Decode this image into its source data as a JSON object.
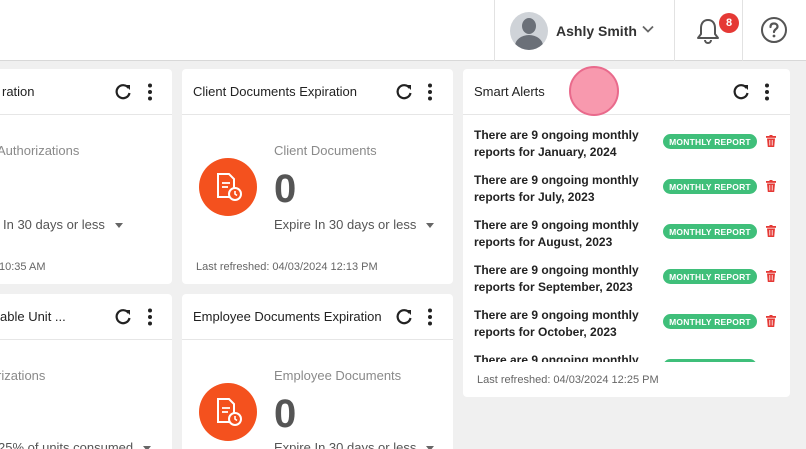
{
  "header": {
    "user_name": "Ashly Smith",
    "notification_count": "8"
  },
  "cards": {
    "authorizations": {
      "title": "ration",
      "stat_label": "Authorizations",
      "expire_text": "In 30 days or less",
      "refreshed": "10:35 AM"
    },
    "client_docs": {
      "title": "Client Documents Expiration",
      "stat_label": "Client Documents",
      "count": "0",
      "expire_text": "Expire In 30 days or less",
      "refreshed": "Last refreshed: 04/03/2024 12:13 PM"
    },
    "billable_units": {
      "title": "able Unit ...",
      "stat_label": "rizations",
      "expire_text": "25% of units consumed"
    },
    "employee_docs": {
      "title": "Employee Documents Expiration",
      "stat_label": "Employee Documents",
      "count": "0",
      "expire_text": "Expire In 30 days or less"
    },
    "smart_alerts": {
      "title": "Smart Alerts",
      "pill_label": "MONTHLY REPORT",
      "alerts": [
        "There are 9 ongoing monthly reports for January, 2024",
        "There are 9 ongoing monthly reports for July, 2023",
        "There are 9 ongoing monthly reports for August, 2023",
        "There are 9 ongoing monthly reports for September, 2023",
        "There are 9 ongoing monthly reports for October, 2023",
        "There are 9 ongoing monthly"
      ],
      "refreshed": "Last refreshed: 04/03/2024 12:25 PM"
    }
  }
}
